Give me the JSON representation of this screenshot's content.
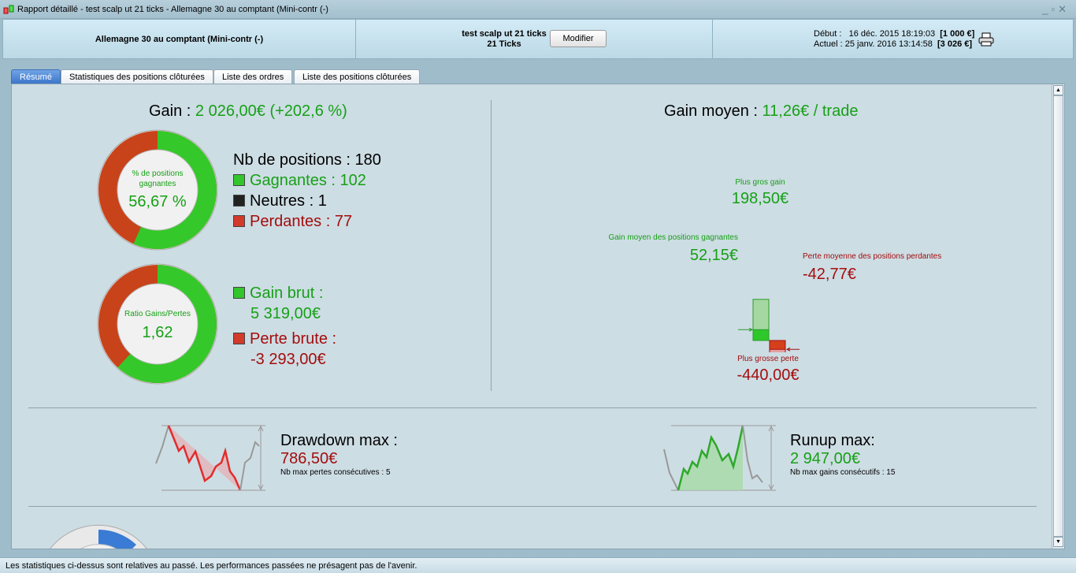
{
  "window": {
    "title": "Rapport détaillé - test scalp ut 21 ticks - Allemagne 30 au comptant (Mini-contr (-)",
    "controls": [
      "minimize",
      "restore",
      "close"
    ]
  },
  "header": {
    "instrument": "Allemagne 30 au comptant (Mini-contr (-)",
    "strategy": "test scalp ut 21 ticks",
    "ticks": "21 Ticks",
    "modify_label": "Modifier",
    "debut_label": "Début :",
    "debut_date": "16 déc. 2015 18:19:03",
    "debut_capital": "[1 000 €]",
    "actuel_label": "Actuel :",
    "actuel_date": "25 janv. 2016 13:14:58",
    "actuel_capital": "[3 026 €]"
  },
  "tabs": [
    {
      "label": "Résumé",
      "active": true
    },
    {
      "label": "Statistiques des positions clôturées"
    },
    {
      "label": "Liste des ordres"
    },
    {
      "label": "Liste des positions clôturées"
    }
  ],
  "summary": {
    "gain_label": "Gain : ",
    "gain_value": "2 026,00€ (+202,6 %)",
    "win_donut": {
      "label": "% de positions gagnantes",
      "value": "56,67 %",
      "fraction": 0.5667
    },
    "positions_label": "Nb de positions : 180",
    "gagnantes": "Gagnantes : 102",
    "neutres": "Neutres : 1",
    "perdantes": "Perdantes : 77",
    "ratio_donut": {
      "label": "Ratio Gains/Pertes",
      "value": "1,62",
      "fraction": 0.6176
    },
    "gain_brut_label": "Gain brut :",
    "gain_brut": "5 319,00€",
    "perte_brute_label": "Perte brute :",
    "perte_brute": "-3 293,00€",
    "gain_moyen_label": "Gain moyen : ",
    "gain_moyen_value": "11,26€ / trade",
    "bars": {
      "max_gain_label": "Plus gros gain",
      "max_gain": "198,50€",
      "max_gain_num": 198.5,
      "avg_gain_label": "Gain moyen des positions gagnantes",
      "avg_gain": "52,15€",
      "avg_gain_num": 52.15,
      "avg_loss_label": "Perte moyenne des positions perdantes",
      "avg_loss": "-42,77€",
      "avg_loss_num": 42.77,
      "max_loss_label": "Plus grosse perte",
      "max_loss": "-440,00€",
      "max_loss_num": 440
    },
    "drawdown_label": "Drawdown max :",
    "drawdown": "786,50€",
    "max_losses": "Nb max pertes consécutives : 5",
    "runup_label": "Runup max:",
    "runup": "2 947,00€",
    "max_gains": "Nb max gains consécutifs : 15"
  },
  "colors": {
    "green": "#16a016",
    "red": "#a30d0d",
    "tab_active": "#3b74c9"
  },
  "status": "Les statistiques ci-dessus sont relatives au passé. Les performances passées ne présagent pas de l'avenir."
}
